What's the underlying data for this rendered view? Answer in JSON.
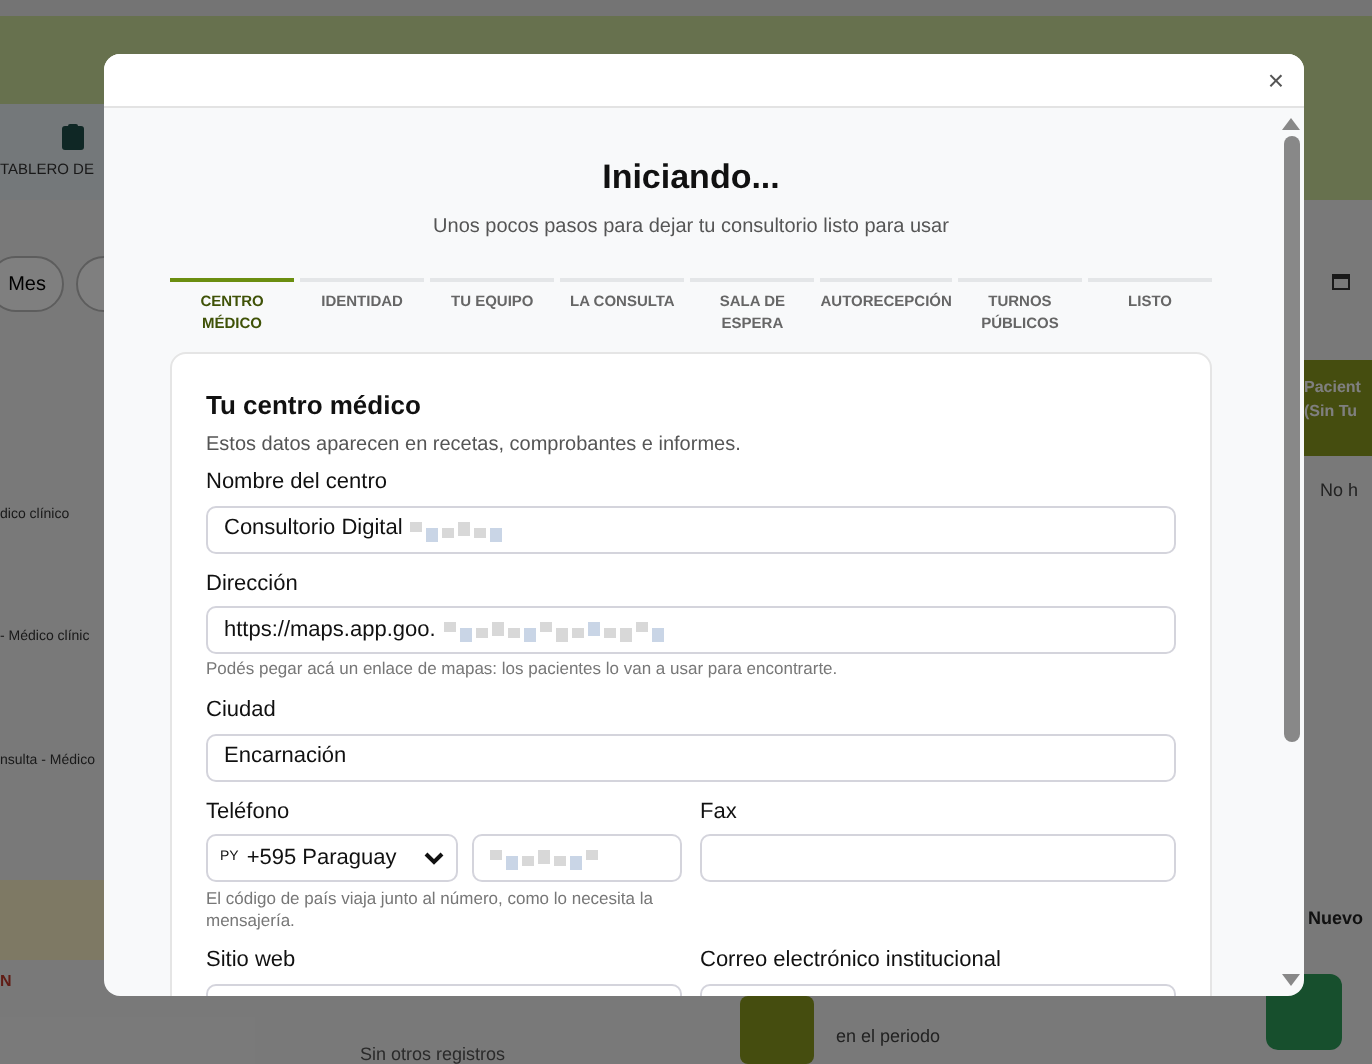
{
  "background": {
    "nav_tab": "TABLERO DE",
    "period_button": "Mes",
    "side_card_title": "Pacient\n(Sin Tu",
    "side_card_empty": "No h",
    "rows": [
      "dico clínico",
      "- Médico clínic",
      "nsulta - Médico"
    ],
    "table_header": "N",
    "empty_text": "Sin otros registros",
    "stat_caption": "en el periodo",
    "new_title": "Nuevo"
  },
  "dialog": {
    "close": "×",
    "title": "Iniciando...",
    "subtitle": "Unos pocos pasos para dejar tu consultorio listo para usar",
    "steps": [
      {
        "label": "CENTRO MÉDICO",
        "selected": true
      },
      {
        "label": "IDENTIDAD",
        "selected": false
      },
      {
        "label": "TU EQUIPO",
        "selected": false
      },
      {
        "label": "LA CONSULTA",
        "selected": false
      },
      {
        "label": "SALA DE ESPERA",
        "selected": false
      },
      {
        "label": "AUTORECEPCIÓN",
        "selected": false
      },
      {
        "label": "TURNOS PÚBLICOS",
        "selected": false
      },
      {
        "label": "LISTO",
        "selected": false
      }
    ],
    "section": {
      "title": "Tu centro médico",
      "description": "Estos datos aparecen en recetas, comprobantes e informes.",
      "fields": [
        {
          "kind": "text",
          "label": "Nombre del centro",
          "value": "Consultorio Digital",
          "redacted": true
        },
        {
          "kind": "text",
          "label": "Dirección",
          "value": "https://maps.app.goo.",
          "redacted": true,
          "hint": "Podés pegar acá un enlace de mapas: los pacientes lo van a usar para encontrarte."
        },
        {
          "kind": "text",
          "label": "Ciudad",
          "value": "Encarnación",
          "redacted": false
        }
      ],
      "phone": {
        "label": "Teléfono",
        "flag": "PY",
        "country": "+595 Paraguay",
        "redacted": true,
        "hint": "El código de país viaja junto al número, como lo necesita la mensajería."
      },
      "fax": {
        "label": "Fax"
      },
      "website": {
        "label": "Sitio web"
      },
      "email": {
        "label": "Correo electrónico institucional"
      }
    }
  }
}
